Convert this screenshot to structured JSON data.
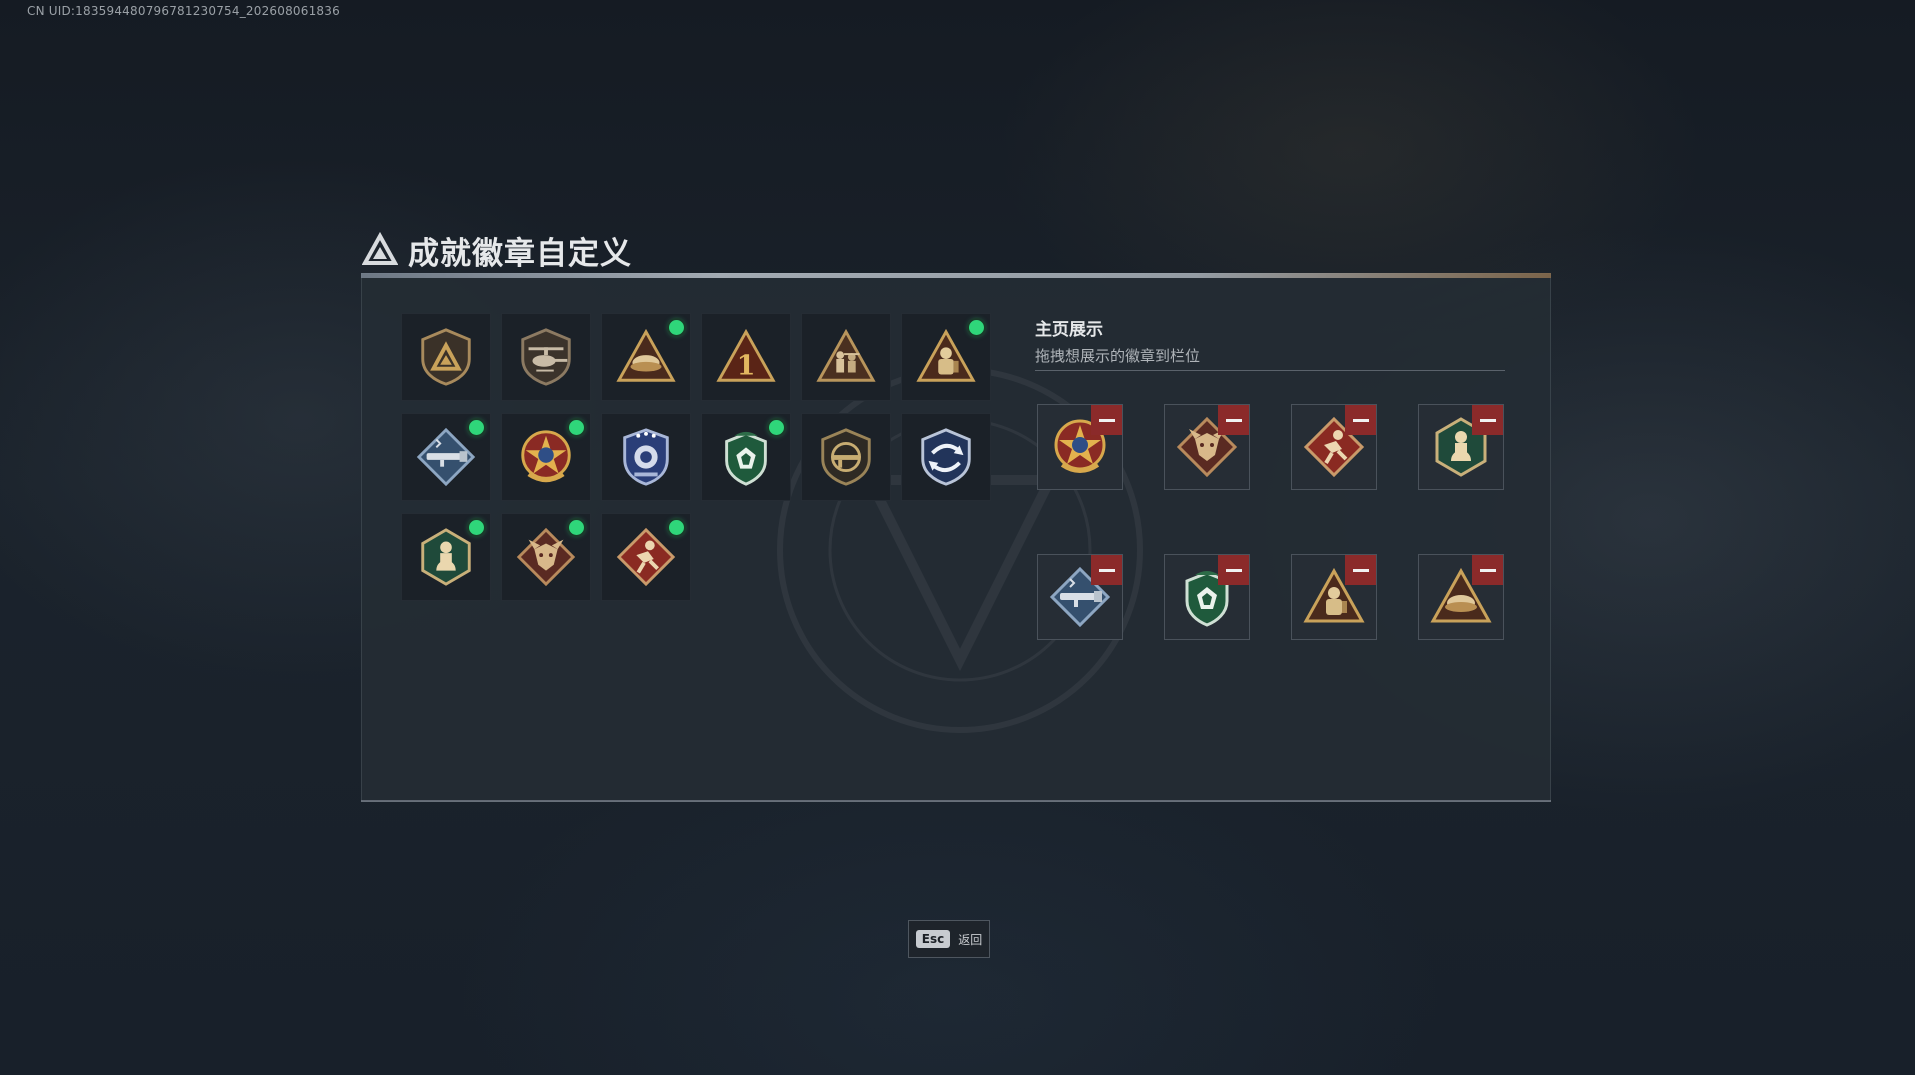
{
  "uid_text": "CN UID:18359448079678123075​4_202608061836",
  "title": "成就徽章自定义",
  "showcase": {
    "title": "主页展示",
    "subtitle": "拖拽想展示的徽章到栏位"
  },
  "badges": [
    {
      "icon": "shield-triangle-icon",
      "new": false
    },
    {
      "icon": "helicopter-badge-icon",
      "new": false
    },
    {
      "icon": "triangle-hands-icon",
      "new": true
    },
    {
      "icon": "triangle-number-one-icon",
      "new": false
    },
    {
      "icon": "triangle-soldiers-icon",
      "new": false
    },
    {
      "icon": "triangle-firefighter-icon",
      "new": true
    },
    {
      "icon": "diamond-rocket-launcher-icon",
      "new": true
    },
    {
      "icon": "star-medal-icon",
      "new": true
    },
    {
      "icon": "blue-police-badge-icon",
      "new": false
    },
    {
      "icon": "green-gem-shield-icon",
      "new": true
    },
    {
      "icon": "gun-shield-icon",
      "new": false
    },
    {
      "icon": "blue-arrows-shield-icon",
      "new": false
    },
    {
      "icon": "hexagon-crouch-figure-icon",
      "new": true
    },
    {
      "icon": "diamond-dragon-icon",
      "new": true
    },
    {
      "icon": "diamond-sprinter-icon",
      "new": true
    }
  ],
  "slots": [
    {
      "icon": "star-medal-icon"
    },
    {
      "icon": "diamond-dragon-icon"
    },
    {
      "icon": "diamond-sprinter-icon"
    },
    {
      "icon": "hexagon-crouch-figure-icon"
    },
    {
      "icon": "diamond-rocket-launcher-icon"
    },
    {
      "icon": "green-gem-shield-icon"
    },
    {
      "icon": "triangle-firefighter-icon"
    },
    {
      "icon": "triangle-hands-icon"
    }
  ],
  "esc": {
    "key": "Esc",
    "label": "返回"
  },
  "colors": {
    "new_dot": "#2fd67a",
    "remove": "#8b2a2a",
    "gold": "#c9a25a",
    "panel": "#242c34"
  }
}
